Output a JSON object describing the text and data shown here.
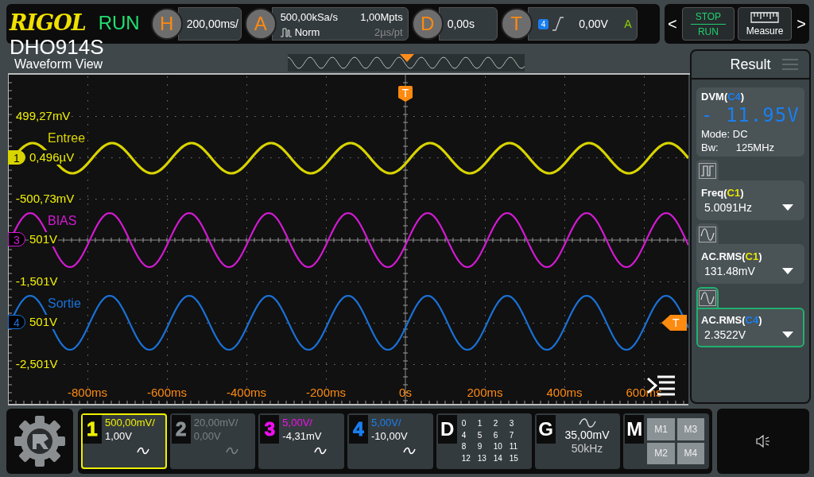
{
  "header": {
    "brand": "RIGOL",
    "run_state": "RUN",
    "model": "DHO914S"
  },
  "horizontal": {
    "key": "H",
    "scale": "200,00ms/"
  },
  "acquisition": {
    "key": "A",
    "sample_rate": "500,00kSa/s",
    "memory_depth": "1,00Mpts",
    "mode": "Norm",
    "time_per_point": "2µs/pt"
  },
  "delay": {
    "key": "D",
    "offset": "0,00s"
  },
  "trigger": {
    "key": "T",
    "source": "4",
    "color": "#1a7ff0",
    "level": "0,00V",
    "sweep": "A"
  },
  "nav": {
    "previous": "<",
    "next": ">"
  },
  "run_control": {
    "stop": "STOP",
    "run": "RUN"
  },
  "measure_button": {
    "label": "Measure"
  },
  "waveform_view": {
    "title": "Waveform View",
    "trigger_marker": "T",
    "trigger_level_marker": "T",
    "voltage_labels": [
      "499,27mV",
      "-500,73mV",
      "-1,501V",
      "-2,501V"
    ],
    "time_labels": [
      "-800ms",
      "-600ms",
      "-400ms",
      "-200ms",
      "0s",
      "200ms",
      "400ms",
      "600ms"
    ],
    "traces": [
      {
        "channel": "1",
        "name": "Entree",
        "offset_label": "0,496µV",
        "color": "#d8d400",
        "selected": true
      },
      {
        "channel": "3",
        "name": "BIAS",
        "offset_label": "501V",
        "color": "#d41ad4",
        "selected": false
      },
      {
        "channel": "4",
        "name": "Sortie",
        "offset_label": "501V",
        "color": "#1a72d8",
        "selected": false
      }
    ]
  },
  "results": {
    "title": "Result",
    "items": [
      {
        "kind": "dvm",
        "name": "DVM(",
        "source": "C4",
        "close": ")",
        "color": "#1a7ff0",
        "value": "- 11.95V",
        "mode": "Mode: DC",
        "bandwidth_label": "Bw:",
        "bandwidth": "125MHz"
      },
      {
        "kind": "frequency",
        "name": "Freq(",
        "source": "C1",
        "close": ")",
        "color": "#e8e400",
        "value": "5.0091Hz",
        "selected": false
      },
      {
        "kind": "rms",
        "name": "AC.RMS(",
        "source": "C1",
        "close": ")",
        "color": "#e8e400",
        "value": "131.48mV",
        "selected": false
      },
      {
        "kind": "rms",
        "name": "AC.RMS(",
        "source": "C4",
        "close": ")",
        "color": "#1a7ff0",
        "value": "2.3522V",
        "selected": true
      }
    ]
  },
  "channels": [
    {
      "number": "1",
      "scale": "500,00mV/",
      "offset": "1,00V",
      "color": "#f0f000",
      "enabled": true,
      "selected": true
    },
    {
      "number": "2",
      "scale": "20,00mV/",
      "offset": "0,00V",
      "color": "#8a9296",
      "enabled": false,
      "selected": false
    },
    {
      "number": "3",
      "scale": "5,00V/",
      "offset": "-4,31mV",
      "color": "#f010f0",
      "enabled": true,
      "selected": false
    },
    {
      "number": "4",
      "scale": "5,00V/",
      "offset": "-10,00V",
      "color": "#1a7ff0",
      "enabled": true,
      "selected": false
    }
  ],
  "digital": {
    "key": "D",
    "bits": [
      "0",
      "1",
      "2",
      "3",
      "4",
      "5",
      "6",
      "7",
      "8",
      "9",
      "10",
      "11",
      "12",
      "13",
      "14",
      "15"
    ]
  },
  "generator": {
    "key": "G",
    "amplitude": "35,00mV",
    "frequency": "50kHz"
  },
  "math": {
    "key": "M",
    "slots": [
      "M1",
      "M3",
      "M2",
      "M4"
    ]
  }
}
